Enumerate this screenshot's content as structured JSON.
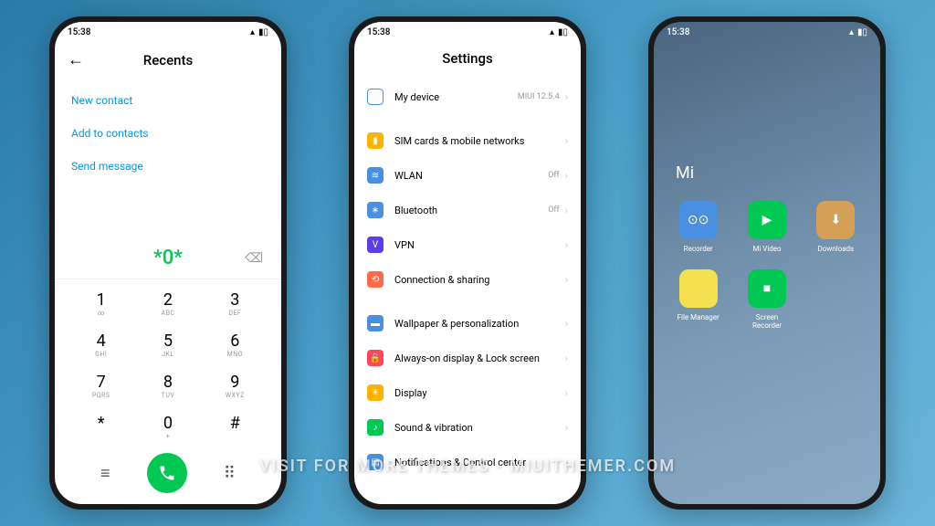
{
  "status_time": "15:38",
  "watermark_text": "VISIT FOR MORE THEMES - MIUITHEMER.COM",
  "dialer": {
    "title": "Recents",
    "actions": [
      {
        "name": "new-contact",
        "label": "New contact"
      },
      {
        "name": "add-to-contacts",
        "label": "Add to contacts"
      },
      {
        "name": "send-message",
        "label": "Send message"
      }
    ],
    "entered_number": "*0*",
    "keys": [
      {
        "num": "1",
        "sub": "∞"
      },
      {
        "num": "2",
        "sub": "ABC"
      },
      {
        "num": "3",
        "sub": "DEF"
      },
      {
        "num": "4",
        "sub": "GHI"
      },
      {
        "num": "5",
        "sub": "JKL"
      },
      {
        "num": "6",
        "sub": "MNO"
      },
      {
        "num": "7",
        "sub": "PQRS"
      },
      {
        "num": "8",
        "sub": "TUV"
      },
      {
        "num": "9",
        "sub": "WXYZ"
      },
      {
        "num": "*",
        "sub": ""
      },
      {
        "num": "0",
        "sub": "+"
      },
      {
        "num": "#",
        "sub": ""
      }
    ]
  },
  "settings": {
    "title": "Settings",
    "items": [
      {
        "name": "my-device",
        "label": "My device",
        "value": "MIUI 12.5.4",
        "icon_color": "#fff",
        "icon_border": "#4a90e2",
        "glyph": "▢"
      },
      {
        "divider": true
      },
      {
        "name": "sim-cards",
        "label": "SIM cards & mobile networks",
        "value": "",
        "icon_color": "#ffb300",
        "glyph": "▮"
      },
      {
        "name": "wlan",
        "label": "WLAN",
        "value": "Off",
        "icon_color": "#4a90e2",
        "glyph": "≋"
      },
      {
        "name": "bluetooth",
        "label": "Bluetooth",
        "value": "Off",
        "icon_color": "#4a90e2",
        "glyph": "∗"
      },
      {
        "name": "vpn",
        "label": "VPN",
        "value": "",
        "icon_color": "#5c3de8",
        "glyph": "V"
      },
      {
        "name": "connection",
        "label": "Connection & sharing",
        "value": "",
        "icon_color": "#ff6b4a",
        "glyph": "⟲"
      },
      {
        "divider": true
      },
      {
        "name": "wallpaper",
        "label": "Wallpaper & personalization",
        "value": "",
        "icon_color": "#4a90e2",
        "glyph": "▬"
      },
      {
        "name": "always-on",
        "label": "Always-on display & Lock screen",
        "value": "",
        "icon_color": "#ff4757",
        "glyph": "🔒"
      },
      {
        "name": "display",
        "label": "Display",
        "value": "",
        "icon_color": "#ffb300",
        "glyph": "☀"
      },
      {
        "name": "sound",
        "label": "Sound & vibration",
        "value": "",
        "icon_color": "#00c853",
        "glyph": "♪"
      },
      {
        "name": "notifications",
        "label": "Notifications & Control center",
        "value": "",
        "icon_color": "#4a90e2",
        "glyph": "▤"
      }
    ]
  },
  "home": {
    "folder_name": "Mi",
    "apps": [
      {
        "name": "recorder",
        "label": "Recorder",
        "color": "#4a90e2",
        "glyph": "⊙⊙"
      },
      {
        "name": "mi-video",
        "label": "Mi Video",
        "color": "#00c853",
        "glyph": "▶"
      },
      {
        "name": "downloads",
        "label": "Downloads",
        "color": "#d4a055",
        "glyph": "⬇"
      },
      {
        "name": "file-manager",
        "label": "File Manager",
        "color": "#f5e050",
        "glyph": ""
      },
      {
        "name": "screen-recorder",
        "label": "Screen Recorder",
        "color": "#00c853",
        "glyph": "■"
      }
    ]
  }
}
